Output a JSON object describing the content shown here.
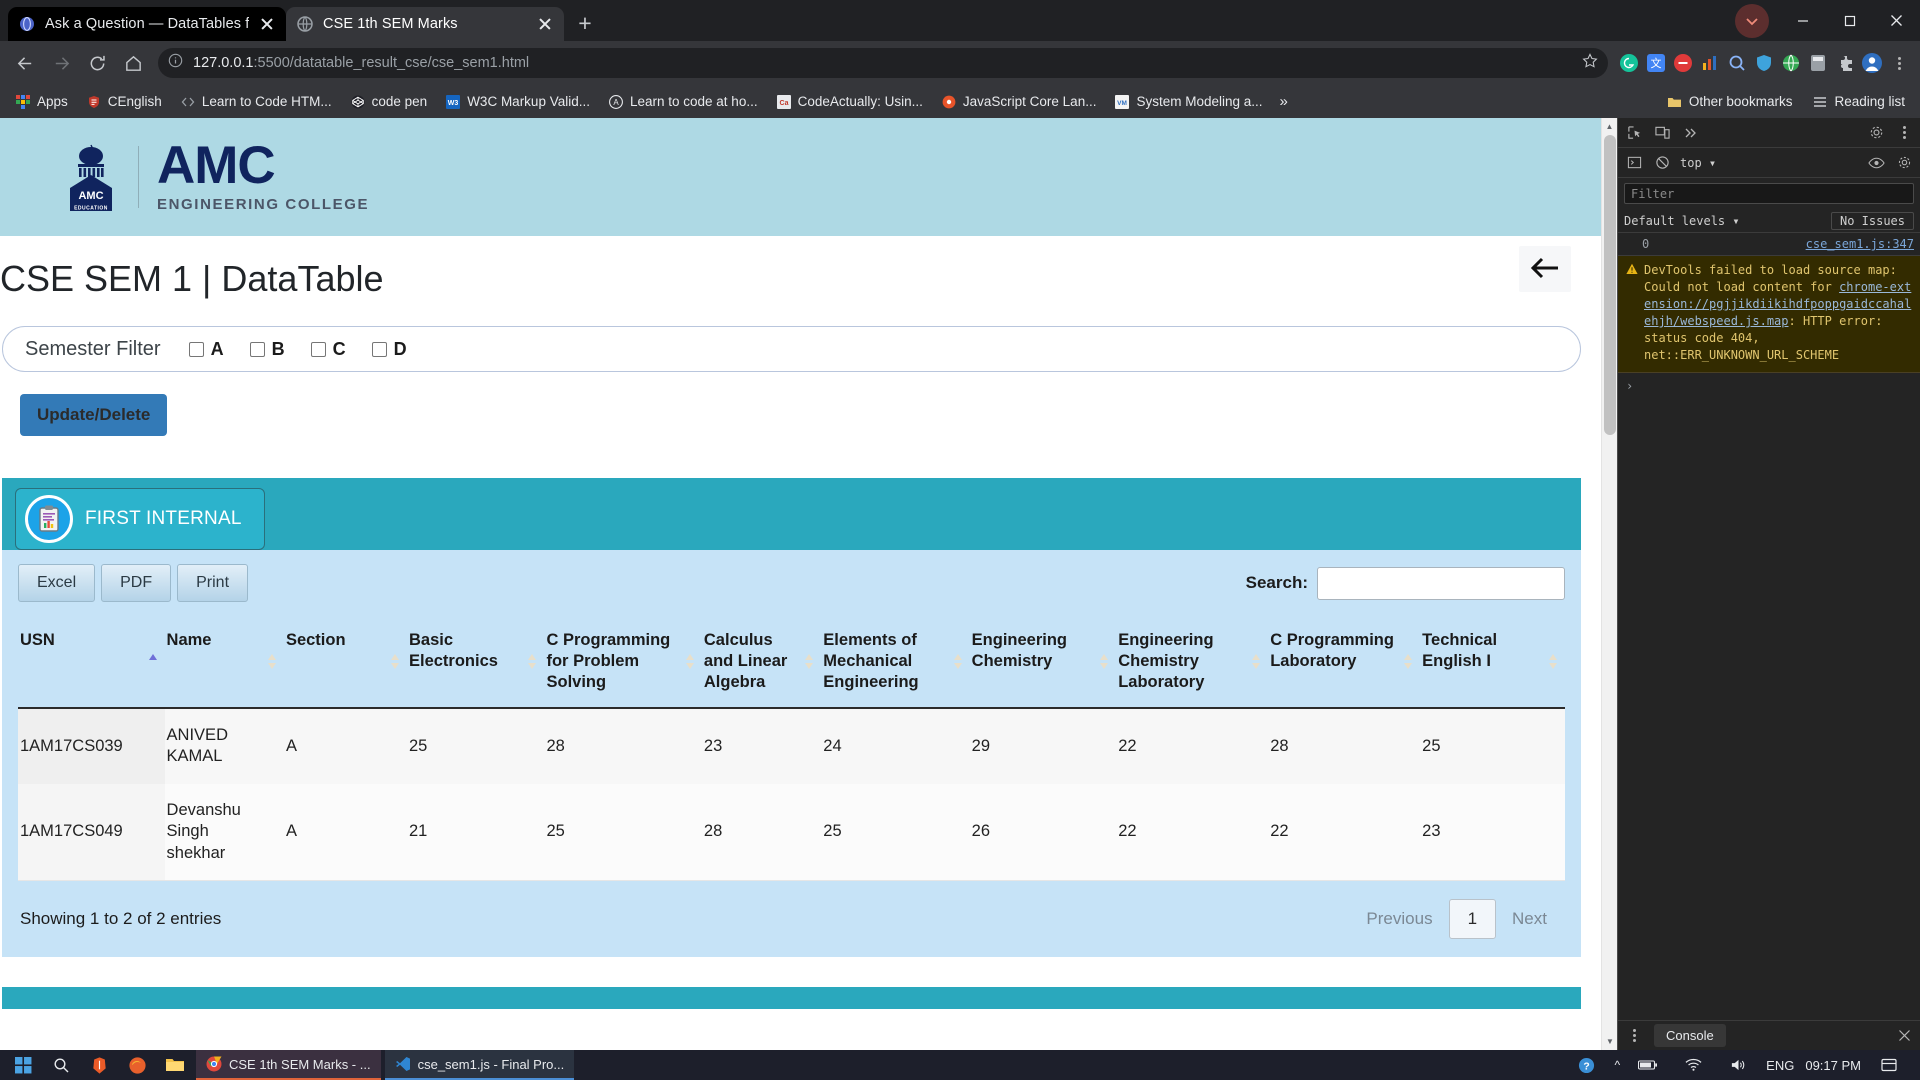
{
  "browser": {
    "tabs": [
      {
        "title": "Ask a Question — DataTables for",
        "favicon": "datatables-icon",
        "active": false
      },
      {
        "title": "CSE 1th SEM Marks",
        "favicon": "globe-icon",
        "active": true
      }
    ],
    "new_tab_label": "+",
    "url_host": "127.0.0.1",
    "url_path": ":5500/datatable_result_cse/cse_sem1.html",
    "url_full": "127.0.0.1:5500/datatable_result_cse/cse_sem1.html",
    "nav": {
      "back": "←",
      "forward": "→",
      "reload": "C",
      "home": "⌂"
    },
    "bookmarks": [
      {
        "label": "Apps",
        "icon": "apps-grid-icon"
      },
      {
        "label": "CEnglish",
        "icon": "shield-icon"
      },
      {
        "label": "Learn to Code HTM...",
        "icon": "code-icon"
      },
      {
        "label": "code pen",
        "icon": "codepen-icon"
      },
      {
        "label": "W3C Markup Valid...",
        "icon": "w3c-icon"
      },
      {
        "label": "Learn to code at ho...",
        "icon": "circle-a-icon"
      },
      {
        "label": "CodeActually: Usin...",
        "icon": "ca-icon"
      },
      {
        "label": "JavaScript Core Lan...",
        "icon": "orange-dot-icon"
      },
      {
        "label": "System Modeling a...",
        "icon": "vm-icon"
      }
    ],
    "bookmarks_overflow": "»",
    "bookmarks_right": [
      {
        "label": "Other bookmarks",
        "icon": "folder-icon"
      },
      {
        "label": "Reading list",
        "icon": "list-icon"
      }
    ],
    "window_controls": {
      "minimize": "—",
      "maximize": "▢",
      "close": "✕"
    }
  },
  "page": {
    "logo": {
      "mark_top": "AMC",
      "mark_bottom": "EDUCATION",
      "name": "AMC",
      "tagline": "ENGINEERING COLLEGE"
    },
    "title": "CSE SEM 1 | DataTable",
    "back_button_icon": "arrow-left-icon",
    "filter": {
      "label": "Semester Filter",
      "options": [
        {
          "label": "A",
          "checked": false
        },
        {
          "label": "B",
          "checked": false
        },
        {
          "label": "C",
          "checked": false
        },
        {
          "label": "D",
          "checked": false
        }
      ]
    },
    "update_delete_label": "Update/Delete",
    "internal_tab": {
      "label": "FIRST INTERNAL",
      "icon": "clipboard-chart-icon"
    },
    "export_buttons": [
      {
        "label": "Excel"
      },
      {
        "label": "PDF"
      },
      {
        "label": "Print"
      }
    ],
    "search": {
      "label": "Search:",
      "value": "",
      "placeholder": ""
    },
    "table": {
      "columns": [
        {
          "label": "USN",
          "sort": "asc"
        },
        {
          "label": "Name",
          "sort": "none"
        },
        {
          "label": "Section",
          "sort": "none"
        },
        {
          "label": "Basic Electronics",
          "sort": "none"
        },
        {
          "label": "C Programming for Problem Solving",
          "sort": "none"
        },
        {
          "label": "Calculus and Linear Algebra",
          "sort": "none"
        },
        {
          "label": "Elements of Mechanical Engineering",
          "sort": "none"
        },
        {
          "label": "Engineering Chemistry",
          "sort": "none"
        },
        {
          "label": "Engineering Chemistry Laboratory",
          "sort": "none"
        },
        {
          "label": "C Programming Laboratory",
          "sort": "none"
        },
        {
          "label": "Technical English I",
          "sort": "none"
        }
      ],
      "rows": [
        [
          "1AM17CS039",
          "ANIVED KAMAL",
          "A",
          "25",
          "28",
          "23",
          "24",
          "29",
          "22",
          "28",
          "25"
        ],
        [
          "1AM17CS049",
          "Devanshu Singh shekhar",
          "A",
          "21",
          "25",
          "28",
          "25",
          "26",
          "22",
          "22",
          "23"
        ]
      ]
    },
    "footer": {
      "info": "Showing 1 to 2 of 2 entries",
      "previous": "Previous",
      "page_number": "1",
      "next": "Next"
    },
    "colors": {
      "header_bg": "#aed9e4",
      "teal": "#2aa8bd",
      "panel": "#c6e3f7",
      "primary": "#337ab7"
    }
  },
  "devtools": {
    "toolbar_icons": [
      "inspect-icon",
      "device-toolbar-icon",
      "more-tabs-icon",
      "settings-gear-icon",
      "more-options-icon"
    ],
    "console_icons": [
      "execute-icon",
      "clear-console-icon"
    ],
    "context": "top",
    "eye_icon": "eye-icon",
    "filter_placeholder": "Filter",
    "levels_label": "Default levels",
    "no_issues_label": "No Issues",
    "source_count": "0",
    "source_link": "cse_sem1.js:347",
    "warning": {
      "icon": "warning-triangle-icon",
      "text_1": "DevTools failed to load source map: Could not load content for ",
      "link": "chrome-extension://pgjjikdiikihdfpoppgaidccahalehjh/webspeed.js.map",
      "text_2": ": HTTP error: status code 404, net::ERR_UNKNOWN_URL_SCHEME"
    },
    "prompt": "›",
    "bottom_tab": "Console"
  },
  "taskbar": {
    "start_icon": "windows-icon",
    "search_icon": "search-icon",
    "pinned": [
      {
        "icon": "brave-icon",
        "name": "brave"
      },
      {
        "icon": "firefox-icon",
        "name": "firefox"
      },
      {
        "icon": "explorer-icon",
        "name": "file-explorer"
      }
    ],
    "windows": [
      {
        "label": "CSE 1th SEM Marks - ...",
        "icon": "chrome-icon",
        "active": true
      },
      {
        "label": "cse_sem1.js - Final Pro...",
        "icon": "vscode-icon",
        "active": false
      }
    ],
    "tray": {
      "help_icon": "help-circle-icon",
      "chevron": "^",
      "battery_icon": "battery-icon",
      "wifi_icon": "wifi-icon",
      "volume_icon": "volume-icon",
      "language": "ENG",
      "clock": "09:17 PM",
      "notification_icon": "notification-icon"
    }
  }
}
